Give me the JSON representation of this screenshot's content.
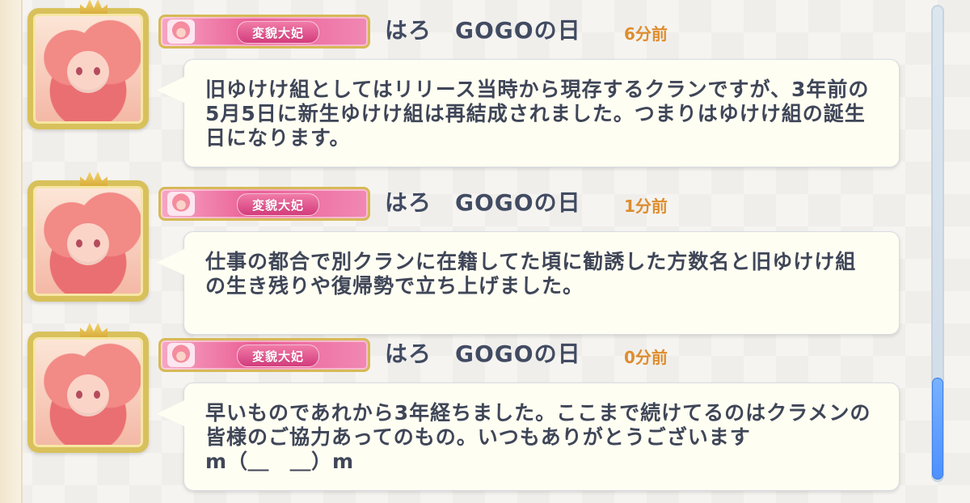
{
  "conversation": {
    "messages": [
      {
        "username": "はろ　GOGOの日",
        "title_badge": "変貌大妃",
        "timestamp": "6分前",
        "text": "旧ゆけけ組としてはリリース当時から現存するクランですが、3年前の5月5日に新生ゆけけ組は再結成されました。つまりはゆけけ組の誕生日になります。"
      },
      {
        "username": "はろ　GOGOの日",
        "title_badge": "変貌大妃",
        "timestamp": "1分前",
        "text": "仕事の都合で別クランに在籍してた頃に勧誘した方数名と旧ゆけけ組の生き残りや復帰勢で立ち上げました。"
      },
      {
        "username": "はろ　GOGOの日",
        "title_badge": "変貌大妃",
        "timestamp": "0分前",
        "text": "早いものであれから3年経ちました。ここまで続けてるのはクラメンの皆様のご協力あってのもの。いつもありがとうございます\nm（＿　＿）m"
      }
    ]
  },
  "colors": {
    "background": "#f6f4f1",
    "bubble": "#fffef2",
    "username": "#414b62",
    "timestamp": "#dd8d2e",
    "badge_pink": "#ea5f96",
    "scrollbar_thumb": "#4d90ff"
  }
}
